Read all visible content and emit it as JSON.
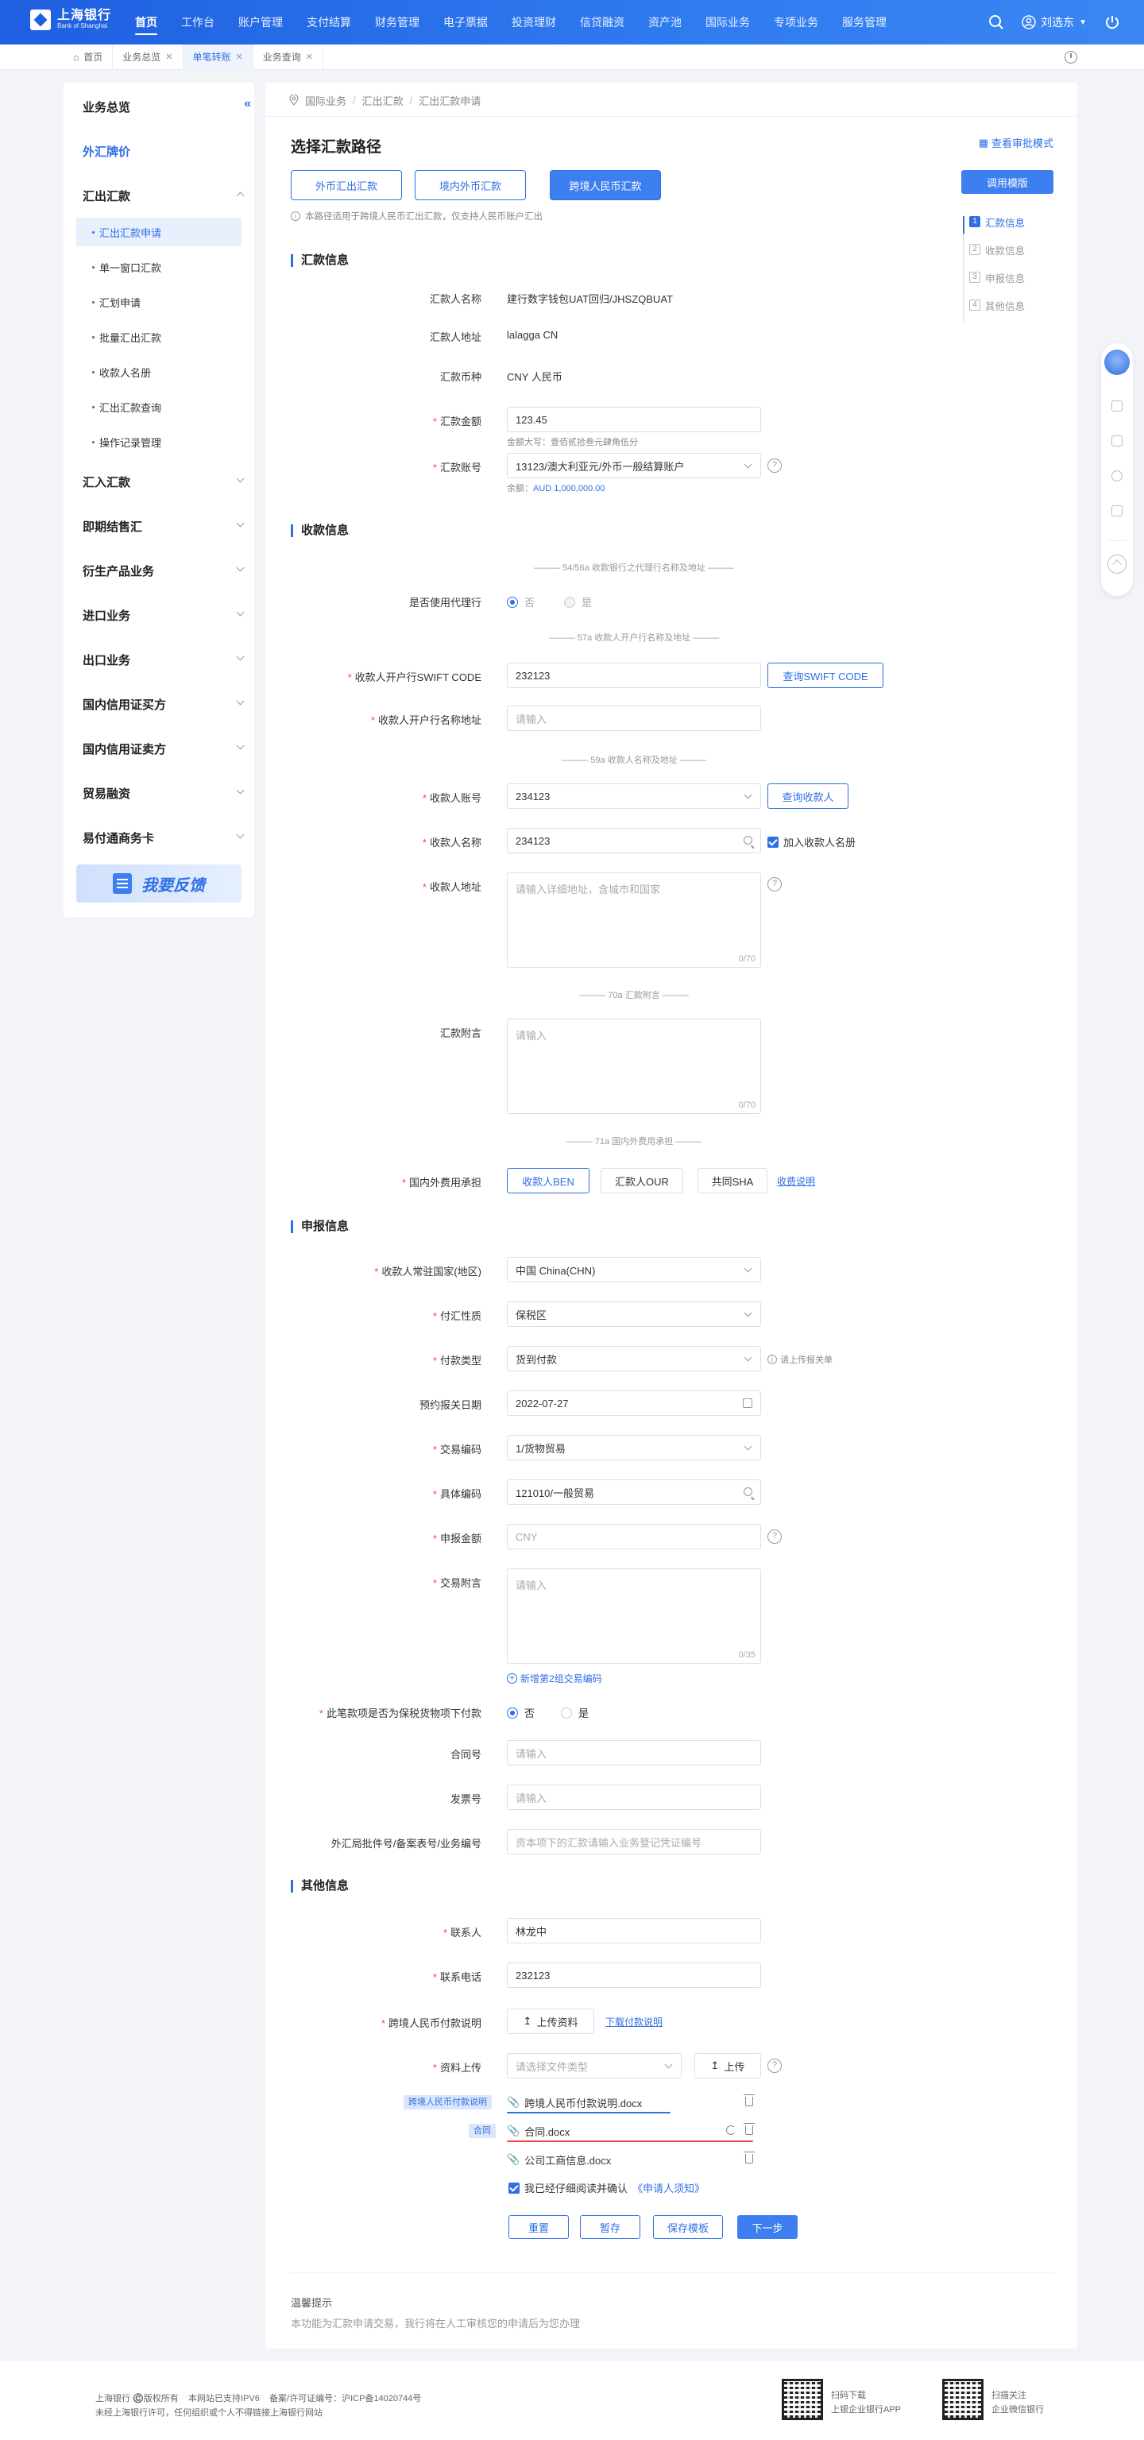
{
  "brand": {
    "cn": "上海银行",
    "en": "Bank of Shanghai"
  },
  "nav": {
    "items": [
      "首页",
      "工作台",
      "账户管理",
      "支付结算",
      "财务管理",
      "电子票据",
      "投资理财",
      "信贷融资",
      "资产池",
      "国际业务",
      "专项业务",
      "服务管理"
    ],
    "user": "刘选东"
  },
  "tabs": [
    "首页",
    "业务总览",
    "单笔转账",
    "业务查询"
  ],
  "sidebar": {
    "overview": "业务总览",
    "fx_rate": "外汇牌价",
    "outward": "汇出汇款",
    "sub": [
      "汇出汇款申请",
      "单一窗口汇款",
      "汇划申请",
      "批量汇出汇款",
      "收款人名册",
      "汇出汇款查询",
      "操作记录管理"
    ],
    "groups": [
      "汇入汇款",
      "即期结售汇",
      "衍生产品业务",
      "进口业务",
      "出口业务",
      "国内信用证买方",
      "国内信用证卖方",
      "贸易融资",
      "易付通商务卡"
    ],
    "feedback": "我要反馈"
  },
  "breadcrumb": [
    "国际业务",
    "汇出汇款",
    "汇出汇款申请"
  ],
  "page": {
    "title": "选择汇款路径",
    "audit": "查看审批模式",
    "template": "调用模版",
    "routes": [
      "外币汇出汇款",
      "境内外币汇款",
      "跨境人民币汇款"
    ],
    "note": "本路径适用于跨境人民币汇出汇款，仅支持人民币账户汇出"
  },
  "steps": [
    {
      "n": "1",
      "label": "汇款信息"
    },
    {
      "n": "2",
      "label": "收款信息"
    },
    {
      "n": "3",
      "label": "申报信息"
    },
    {
      "n": "4",
      "label": "其他信息"
    }
  ],
  "remit": {
    "title": "汇款信息",
    "name_label": "汇款人名称",
    "name": "建行数字钱包UAT回归/JHSZQBUAT",
    "addr_label": "汇款人地址",
    "addr": "lalagga CN",
    "cur_label": "汇款币种",
    "cur": "CNY 人民币",
    "amt_label": "汇款金额",
    "amt": "123.45",
    "amt_words": "金额大写：壹佰贰拾叁元肆角伍分",
    "acct_label": "汇款账号",
    "acct": "13123/澳大利亚元/外币一般结算账户",
    "bal_label": "余额：",
    "bal": "AUD 1,000,000.00"
  },
  "payee": {
    "title": "收款信息",
    "div_agent": "54/56a 收款银行之代理行名称及地址",
    "agent_label": "是否使用代理行",
    "no": "否",
    "yes": "是",
    "div_bank": "57a 收款人开户行名称及地址",
    "swift_label": "收款人开户行SWIFT CODE",
    "swift": "232123",
    "swift_btn": "查询SWIFT CODE",
    "bankname_label": "收款人开户行名称地址",
    "bankname_ph": "请输入",
    "div_payee": "59a 收款人名称及地址",
    "acct_label": "收款人账号",
    "acct": "234123",
    "acct_btn": "查询收款人",
    "name_label": "收款人名称",
    "name": "234123",
    "add_book": "加入收款人名册",
    "addr_label": "收款人地址",
    "addr_ph": "请输入详细地址，含城市和国家",
    "addr_count": "0/70",
    "div_memo": "70a 汇款附言",
    "memo_label": "汇款附言",
    "memo_ph": "请输入",
    "memo_count": "0/70",
    "div_fee": "71a 国内外费用承担",
    "fee_label": "国内外费用承担",
    "fee_opts": [
      "收款人BEN",
      "汇款人OUR",
      "共同SHA"
    ],
    "fee_link": "收费说明"
  },
  "report": {
    "title": "申报信息",
    "country_label": "收款人常驻国家(地区)",
    "country": "中国 China(CHN)",
    "nature_label": "付汇性质",
    "nature": "保税区",
    "type_label": "付款类型",
    "type": "货到付款",
    "type_hint": "请上传报关单",
    "date_label": "预约报关日期",
    "date": "2022-07-27",
    "code_label": "交易编码",
    "code": "1/货物贸易",
    "spec_label": "具体编码",
    "spec": "121010/一般贸易",
    "decl_label": "申报金额",
    "decl_ph": "CNY",
    "memo_label": "交易附言",
    "memo_ph": "请输入",
    "memo_count": "0/35",
    "add_code": "新增第2组交易编码",
    "bonded_label": "此笔款项是否为保税货物项下付款",
    "no": "否",
    "yes": "是",
    "contract_label": "合同号",
    "contract_ph": "请输入",
    "invoice_label": "发票号",
    "invoice_ph": "请输入",
    "approval_label": "外汇局批件号/备案表号/业务编号",
    "approval_ph": "资本项下的汇款请输入业务登记凭证编号"
  },
  "other": {
    "title": "其他信息",
    "contact_label": "联系人",
    "contact": "林龙中",
    "phone_label": "联系电话",
    "phone": "232123",
    "rmbdesc_label": "跨境人民币付款说明",
    "upload_btn": "上传资料",
    "download_link": "下载付款说明",
    "upload_label": "资料上传",
    "filetype_ph": "请选择文件类型",
    "upload2": "上传",
    "tag1": "跨境人民币付款说明",
    "tag2": "合同",
    "files": [
      "跨境人民币付款说明.docx",
      "合同.docx",
      "公司工商信息.docx"
    ],
    "agree_prefix": "我已经仔细阅读并确认",
    "agree_link": "《申请人须知》"
  },
  "actions": [
    "重置",
    "暂存",
    "保存模板",
    "下一步"
  ],
  "tips": {
    "title": "温馨提示",
    "text": "本功能为汇款申请交易，我行将在人工审核您的申请后为您办理"
  },
  "footer": {
    "line1": "上海银行 ©️版权所有    本网站已支持IPV6    备案/许可证编号：沪ICP备14020744号",
    "line2": "未经上海银行许可，任何组织或个人不得链接上海银行网站",
    "qr1a": "扫码下载",
    "qr1b": "上银企业银行APP",
    "qr2a": "扫描关注",
    "qr2b": "企业微信银行"
  }
}
